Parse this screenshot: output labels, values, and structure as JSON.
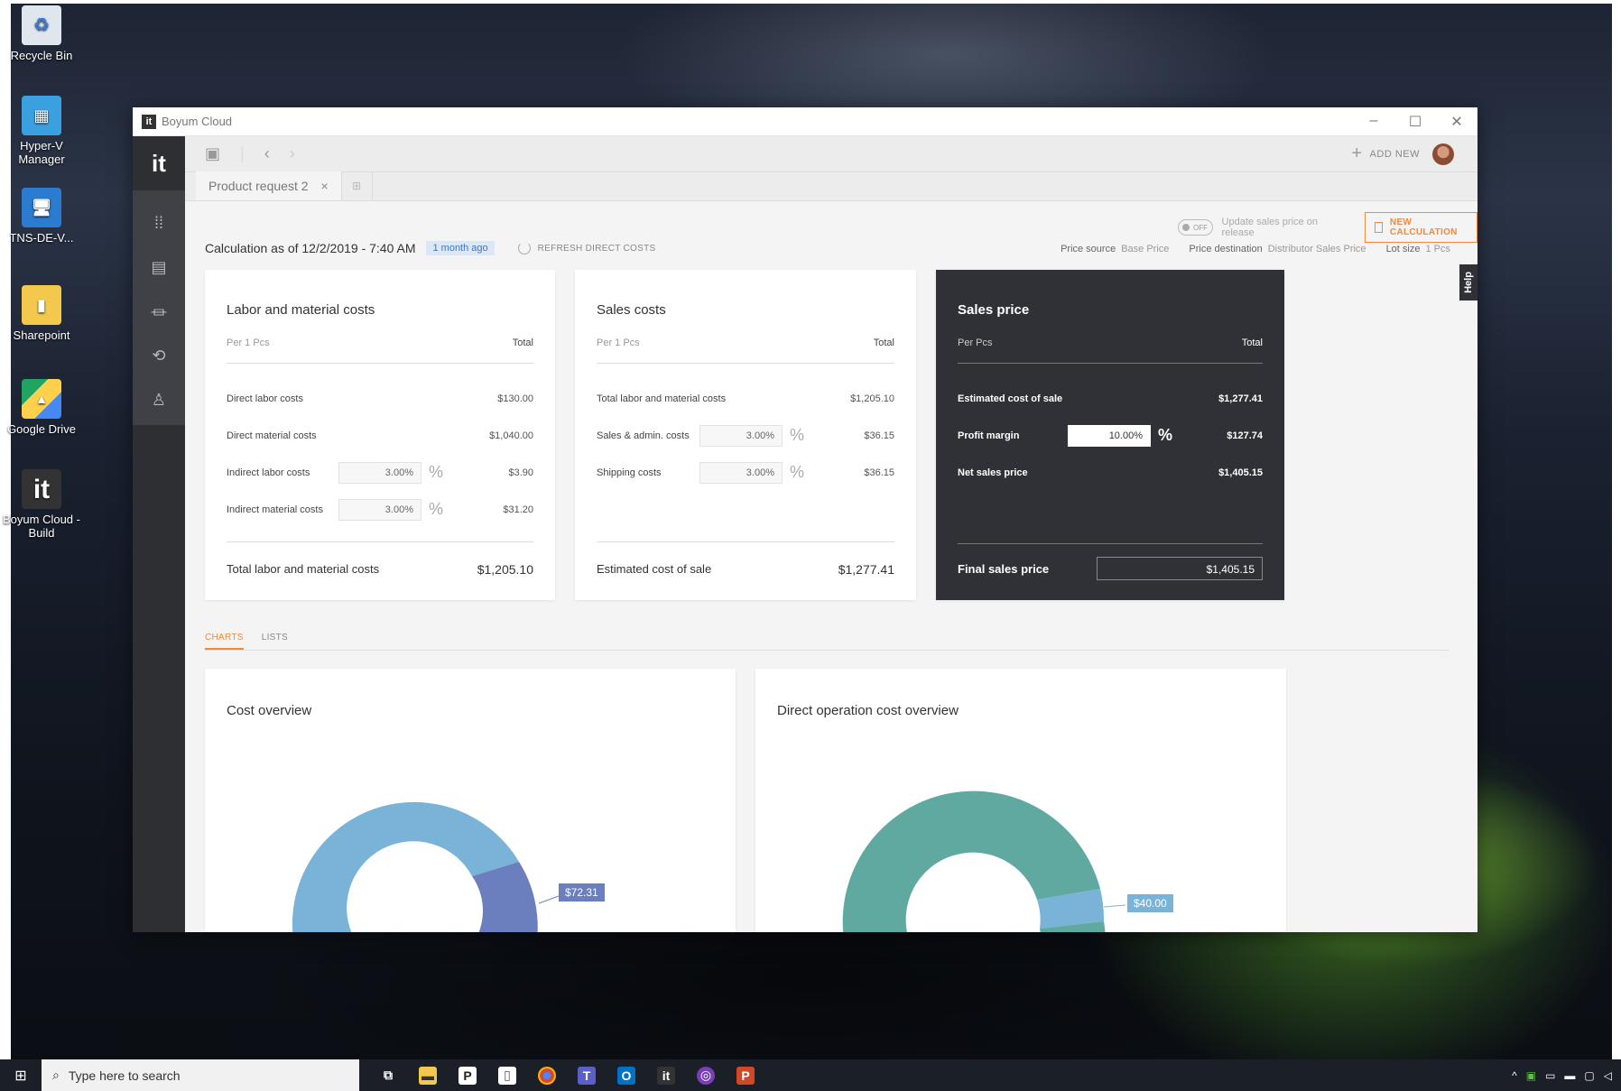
{
  "desktop": {
    "icons": [
      {
        "label": "Recycle Bin"
      },
      {
        "label": "Hyper-V Manager"
      },
      {
        "label": "TNS-DE-V..."
      },
      {
        "label": "Sharepoint"
      },
      {
        "label": "Google Drive"
      },
      {
        "label": "Boyum Cloud - Build"
      }
    ]
  },
  "window": {
    "title": "Boyum Cloud",
    "minimize": "–",
    "maximize": "☐",
    "close": "✕"
  },
  "sidebar": {
    "logo": "it"
  },
  "toolbar": {
    "add_new": "ADD NEW"
  },
  "tabs": {
    "doc_tab": "Product request 2",
    "close": "×"
  },
  "controls": {
    "toggle_state": "OFF",
    "toggle_label": "Update sales price on release",
    "new_calculation": "NEW CALCULATION"
  },
  "calc": {
    "label": "Calculation as of 12/2/2019 - 7:40 AM",
    "badge": "1 month ago",
    "refresh": "REFRESH DIRECT COSTS"
  },
  "price_info": {
    "source_label": "Price source",
    "source_value": "Base Price",
    "dest_label": "Price destination",
    "dest_value": "Distributor Sales Price",
    "lot_label": "Lot size",
    "lot_value": "1 Pcs"
  },
  "labor_card": {
    "title": "Labor and material costs",
    "per": "Per 1 Pcs",
    "total_hdr": "Total",
    "rows": [
      {
        "label": "Direct labor costs",
        "value": "$130.00"
      },
      {
        "label": "Direct material costs",
        "value": "$1,040.00"
      },
      {
        "label": "Indirect labor costs",
        "pct": "3.00%",
        "value": "$3.90"
      },
      {
        "label": "Indirect material costs",
        "pct": "3.00%",
        "value": "$31.20"
      }
    ],
    "total_label": "Total labor and material costs",
    "total_value": "$1,205.10"
  },
  "sales_card": {
    "title": "Sales costs",
    "per": "Per 1 Pcs",
    "total_hdr": "Total",
    "rows": [
      {
        "label": "Total labor and material costs",
        "value": "$1,205.10"
      },
      {
        "label": "Sales & admin. costs",
        "pct": "3.00%",
        "value": "$36.15"
      },
      {
        "label": "Shipping costs",
        "pct": "3.00%",
        "value": "$36.15"
      }
    ],
    "total_label": "Estimated cost of sale",
    "total_value": "$1,277.41"
  },
  "price_card": {
    "title": "Sales price",
    "per": "Per Pcs",
    "total_hdr": "Total",
    "rows": [
      {
        "label": "Estimated cost of sale",
        "value": "$1,277.41"
      },
      {
        "label": "Profit margin",
        "pct": "10.00%",
        "value": "$127.74"
      },
      {
        "label": "Net sales price",
        "value": "$1,405.15"
      }
    ],
    "final_label": "Final sales price",
    "final_value": "$1,405.15"
  },
  "help": "Help",
  "view_tabs": {
    "charts": "CHARTS",
    "lists": "LISTS"
  },
  "charts": {
    "cost_overview": {
      "title": "Cost overview",
      "label": "$72.31"
    },
    "direct_op": {
      "title": "Direct operation cost overview",
      "label": "$40.00"
    }
  },
  "taskbar": {
    "search_placeholder": "Type here to search"
  },
  "colors": {
    "accent": "#f08a3c",
    "dark_card": "#2f3136",
    "donut_blue": "#7ab3d8",
    "donut_teal": "#5fa9a0",
    "donut_navy": "#6b7fbf"
  }
}
